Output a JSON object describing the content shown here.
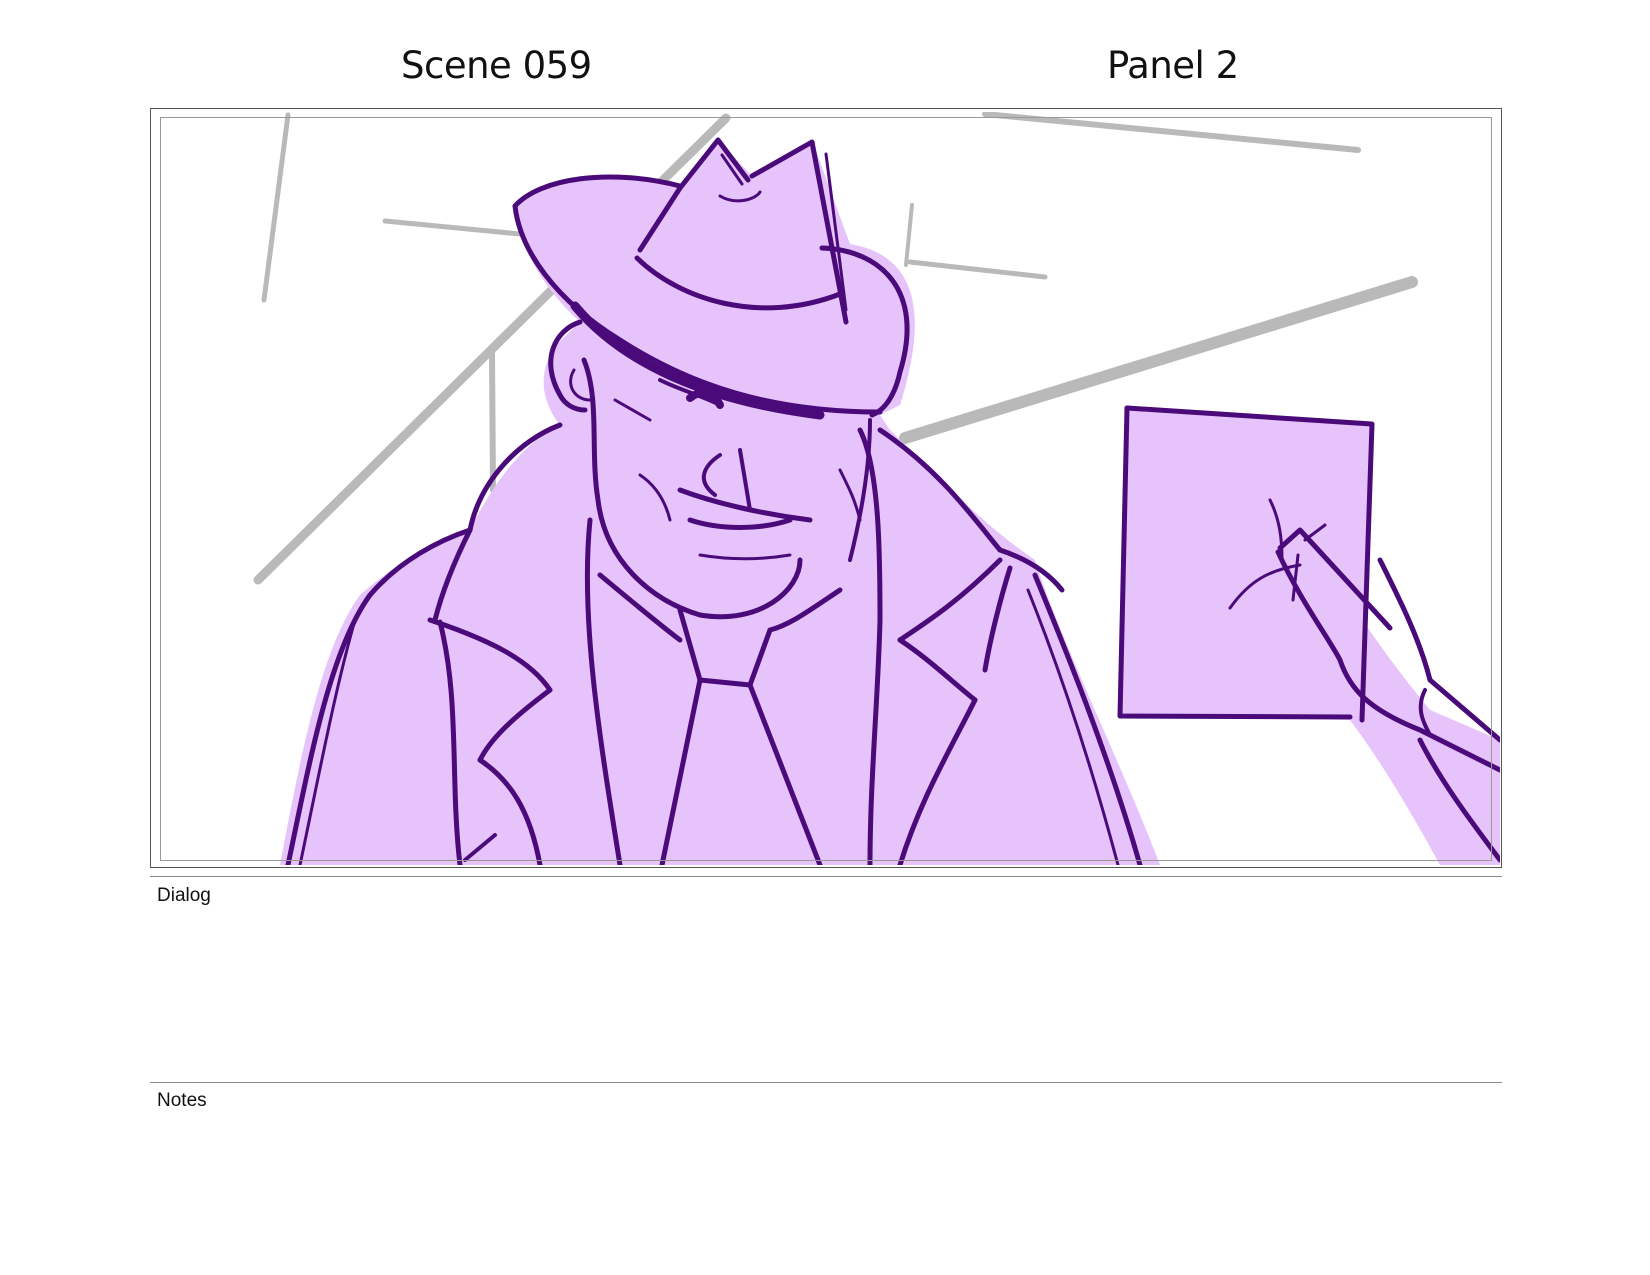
{
  "header": {
    "scene": "Scene 059",
    "panel": "Panel 2"
  },
  "sections": {
    "dialog_label": "Dialog",
    "notes_label": "Notes"
  },
  "colors": {
    "line_purple": "#4a0a7a",
    "fill_lavender": "#e6c3fb",
    "bg_lines_gray": "#b9b9b9"
  }
}
